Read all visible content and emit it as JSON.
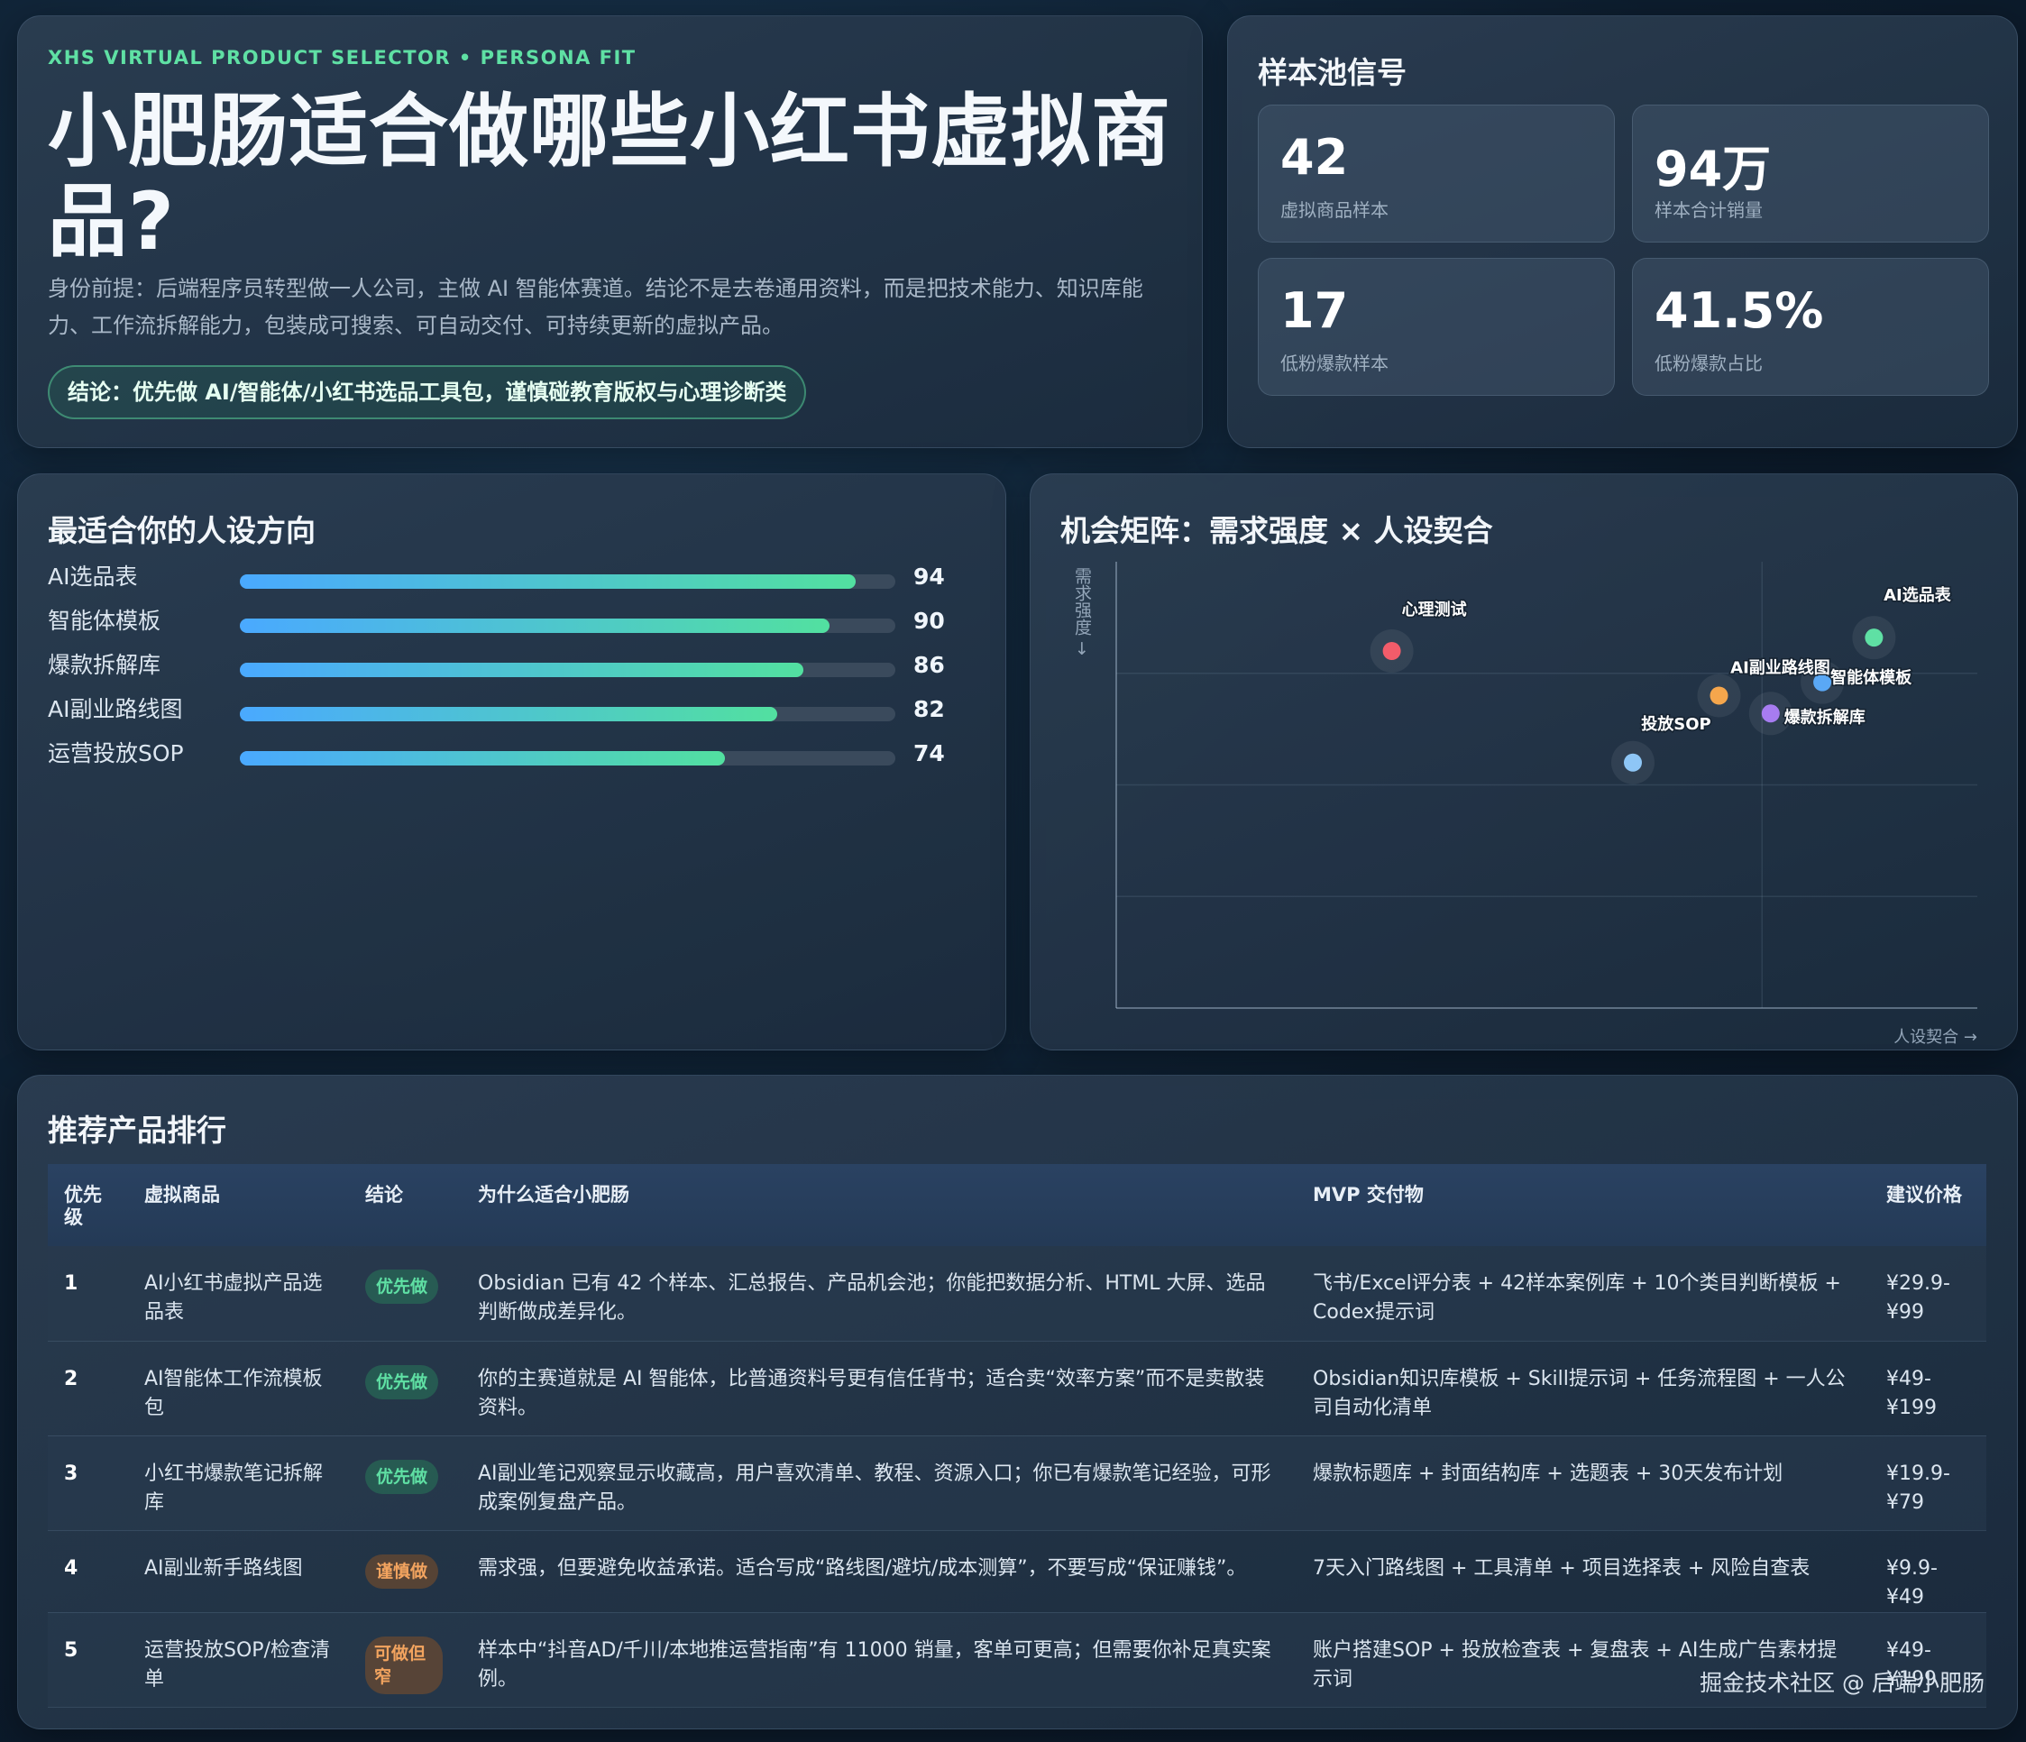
{
  "hero": {
    "eyebrow": "XHS VIRTUAL PRODUCT SELECTOR • PERSONA FIT",
    "title": "小肥肠适合做哪些小红书虚拟商品?",
    "description": "身份前提：后端程序员转型做一人公司，主做 AI 智能体赛道。结论不是去卷通用资料，而是把技术能力、知识库能力、工作流拆解能力，包装成可搜索、可自动交付、可持续更新的虚拟产品。",
    "conclusion": "结论：优先做 AI/智能体/小红书选品工具包，谨慎碰教育版权与心理诊断类"
  },
  "stats": {
    "title": "样本池信号",
    "items": [
      {
        "value": "42",
        "label": "虚拟商品样本"
      },
      {
        "value": "94万",
        "label": "样本合计销量"
      },
      {
        "value": "17",
        "label": "低粉爆款样本"
      },
      {
        "value": "41.5%",
        "label": "低粉爆款占比"
      }
    ]
  },
  "persona": {
    "title": "最适合你的人设方向",
    "items": [
      {
        "label": "AI选品表",
        "value": 94
      },
      {
        "label": "智能体模板",
        "value": 90
      },
      {
        "label": "爆款拆解库",
        "value": 86
      },
      {
        "label": "AI副业路线图",
        "value": 82
      },
      {
        "label": "运营投放SOP",
        "value": 74
      }
    ]
  },
  "matrix": {
    "title": "机会矩阵：需求强度 × 人设契合",
    "ylabel": "需求强度 →",
    "xlabel": "人设契合 →"
  },
  "chart_data": {
    "type": "scatter",
    "title": "机会矩阵：需求强度 × 人设契合",
    "xlabel": "人设契合",
    "ylabel": "需求强度",
    "xlim": [
      0,
      100
    ],
    "ylim": [
      0,
      100
    ],
    "grid": true,
    "points": [
      {
        "label": "心理测试",
        "x": 32,
        "y": 80,
        "color": "#f25c6a"
      },
      {
        "label": "AI选品表",
        "x": 88,
        "y": 83,
        "color": "#5fe0a4"
      },
      {
        "label": "智能体模板",
        "x": 82,
        "y": 73,
        "color": "#5aa8f5"
      },
      {
        "label": "爆款拆解库",
        "x": 76,
        "y": 66,
        "color": "#a77cf0"
      },
      {
        "label": "AI副业路线图",
        "x": 70,
        "y": 70,
        "color": "#f5a64c"
      },
      {
        "label": "投放SOP",
        "x": 60,
        "y": 55,
        "color": "#8ec6f6"
      }
    ]
  },
  "ranking": {
    "title": "推荐产品排行",
    "headers": [
      "优先级",
      "虚拟商品",
      "结论",
      "为什么适合小肥肠",
      "MVP 交付物",
      "建议价格"
    ],
    "rows": [
      {
        "rank": "1",
        "product": "AI小红书虚拟产品选品表",
        "verdict": "优先做",
        "why": "Obsidian 已有 42 个样本、汇总报告、产品机会池；你能把数据分析、HTML 大屏、选品判断做成差异化。",
        "mvp": "飞书/Excel评分表 + 42样本案例库 + 10个类目判断模板 + Codex提示词",
        "price": "¥29.9-¥99"
      },
      {
        "rank": "2",
        "product": "AI智能体工作流模板包",
        "verdict": "优先做",
        "why": "你的主赛道就是 AI 智能体，比普通资料号更有信任背书；适合卖“效率方案”而不是卖散装资料。",
        "mvp": "Obsidian知识库模板 + Skill提示词 + 任务流程图 + 一人公司自动化清单",
        "price": "¥49-¥199"
      },
      {
        "rank": "3",
        "product": "小红书爆款笔记拆解库",
        "verdict": "优先做",
        "why": "AI副业笔记观察显示收藏高，用户喜欢清单、教程、资源入口；你已有爆款笔记经验，可形成案例复盘产品。",
        "mvp": "爆款标题库 + 封面结构库 + 选题表 + 30天发布计划",
        "price": "¥19.9-¥79"
      },
      {
        "rank": "4",
        "product": "AI副业新手路线图",
        "verdict": "谨慎做",
        "why": "需求强，但要避免收益承诺。适合写成“路线图/避坑/成本测算”，不要写成“保证赚钱”。",
        "mvp": "7天入门路线图 + 工具清单 + 项目选择表 + 风险自查表",
        "price": "¥9.9-¥49"
      },
      {
        "rank": "5",
        "product": "运营投放SOP/检查清单",
        "verdict": "可做但窄",
        "why": "样本中“抖音AD/千川/本地推运营指南”有 11000 销量，客单可更高；但需要你补足真实案例。",
        "mvp": "账户搭建SOP + 投放检查表 + 复盘表 + AI生成广告素材提示词",
        "price": "¥49-¥199"
      }
    ]
  },
  "footer": {
    "watermark": "掘金技术社区 @ 后端小肥肠"
  }
}
